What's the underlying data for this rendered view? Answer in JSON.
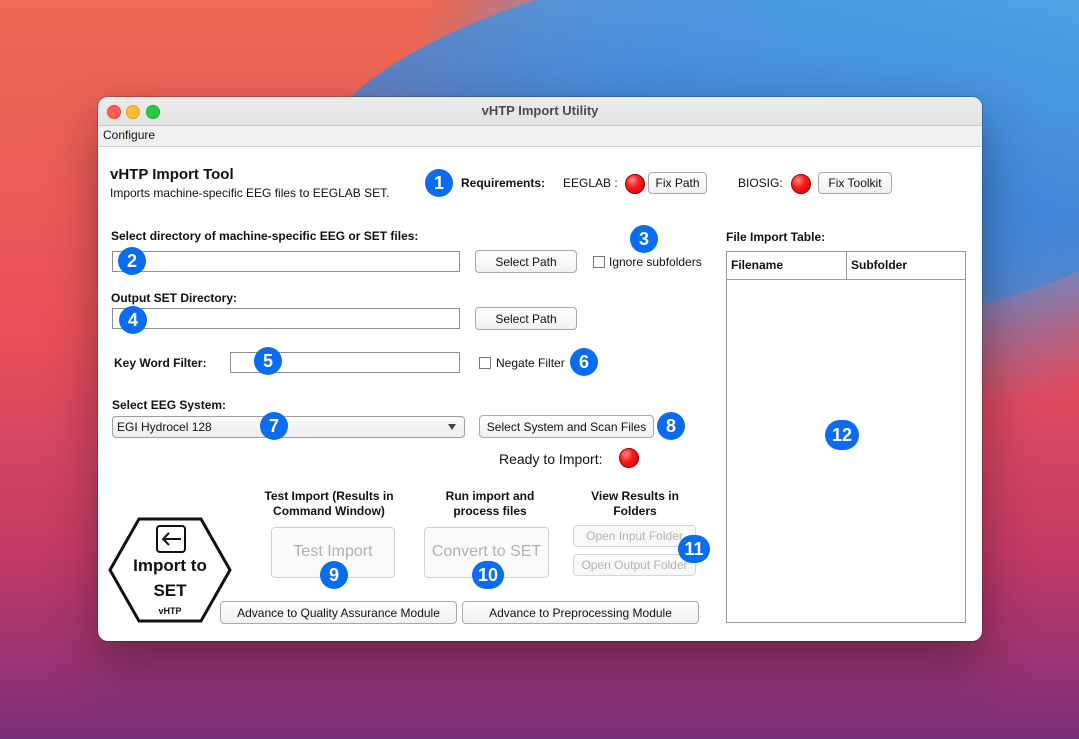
{
  "window": {
    "title": "vHTP Import Utility"
  },
  "menu": {
    "configure": "Configure"
  },
  "header": {
    "title": "vHTP Import Tool",
    "subtitle": "Imports machine-specific EEG files to EEGLAB SET."
  },
  "requirements": {
    "label": "Requirements:",
    "eeglab_label": "EEGLAB :",
    "fix_path": "Fix Path",
    "biosig_label": "BIOSIG:",
    "fix_toolkit": "Fix Toolkit"
  },
  "input_dir": {
    "label": "Select directory of machine-specific EEG or SET files:",
    "value": "",
    "select_path": "Select Path",
    "ignore_subfolders": "Ignore subfolders"
  },
  "output_dir": {
    "label": "Output SET Directory:",
    "value": "",
    "select_path": "Select Path"
  },
  "keyword": {
    "label": "Key Word Filter:",
    "value": "",
    "negate": "Negate Filter"
  },
  "eeg_system": {
    "label": "Select EEG System:",
    "selected": "EGI Hydrocel 128",
    "scan_button": "Select System and Scan Files"
  },
  "status": {
    "ready": "Ready to Import:"
  },
  "actions": {
    "test_header": "Test Import (Results in Command Window)",
    "test_button": "Test Import",
    "run_header": "Run import and process files",
    "run_button": "Convert to SET",
    "view_header": "View Results in Folders",
    "open_input": "Open Input Folder",
    "open_output": "Open Output Folder",
    "advance_qa": "Advance to Quality Assurance Module",
    "advance_pre": "Advance to Preprocessing Module"
  },
  "logo": {
    "line1": "Import to",
    "line2": "SET",
    "line3": "vHTP"
  },
  "file_table": {
    "label": "File Import Table:",
    "columns": [
      "Filename",
      "Subfolder"
    ],
    "rows": []
  },
  "badges": [
    "1",
    "2",
    "3",
    "4",
    "5",
    "6",
    "7",
    "8",
    "9",
    "10",
    "11",
    "12"
  ],
  "colors": {
    "badge": "#0a6cf0",
    "led_off": "#ff1a1a"
  }
}
